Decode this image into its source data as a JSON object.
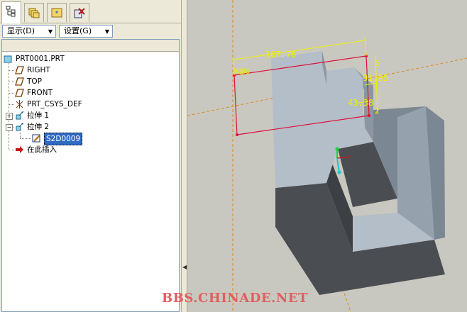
{
  "tabs": [
    {
      "name": "model-tree-tab",
      "active": true
    },
    {
      "name": "folder-browser-tab",
      "active": false
    },
    {
      "name": "favorites-tab",
      "active": false
    },
    {
      "name": "connections-tab",
      "active": false
    }
  ],
  "toolbar": {
    "display_label": "显示(D)",
    "settings_label": "设置(G)"
  },
  "tree": {
    "root": "PRT0001.PRT",
    "items": [
      {
        "label": "RIGHT",
        "icon": "datum-plane-icon"
      },
      {
        "label": "TOP",
        "icon": "datum-plane-icon"
      },
      {
        "label": "FRONT",
        "icon": "datum-plane-icon"
      },
      {
        "label": "PRT_CSYS_DEF",
        "icon": "coordinate-system-icon"
      },
      {
        "label": "拉伸 1",
        "icon": "extrude-icon"
      },
      {
        "label": "拉伸 2",
        "icon": "extrude-icon"
      },
      {
        "label": "S2D0009",
        "icon": "sketch-icon",
        "selected": true
      },
      {
        "label": "在此插入",
        "icon": "insert-here-arrow-icon"
      }
    ]
  },
  "viewport": {
    "sketch_plane_label": "前部0",
    "dim_width": "167.76",
    "dim_right": "91.05",
    "dim_inner": "43.38",
    "dim_height_1": "6",
    "dim_height_2": "2",
    "colors": {
      "background": "#c8c8c0",
      "part_light": "#b4bec8",
      "part_shadow": "#4a4e52",
      "sketch_line": "#e0103a",
      "dimension": "#f0f000",
      "datum_axis": "#e08a20"
    }
  },
  "watermark": "BBS.CHINADE.NET"
}
